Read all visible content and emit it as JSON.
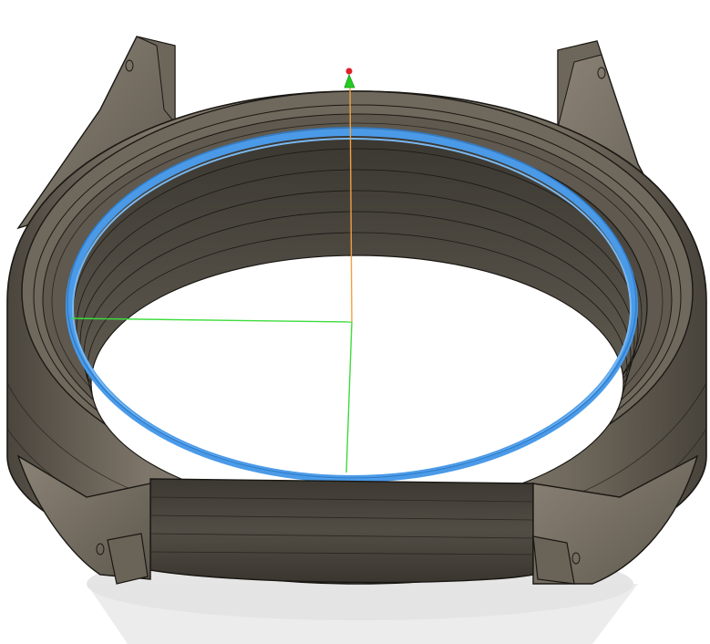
{
  "viewport": {
    "background": "#ffffff",
    "model": {
      "body_color": "#7a7265",
      "body_dark": "#3e3a33",
      "edge_color": "#1a1814",
      "shadow_color": "#dcdcdc",
      "selection_color": "#4a9ae8"
    },
    "triad": {
      "x_axis_color": "#3ddc3d",
      "y_axis_color": "#3ddc3d",
      "z_axis_color": "#f0a040",
      "arrow_color": "#22cc22",
      "tip_color": "#e0202a"
    },
    "icons": {
      "origin": "origin-triad-icon",
      "arrow": "drag-arrow-icon"
    }
  }
}
